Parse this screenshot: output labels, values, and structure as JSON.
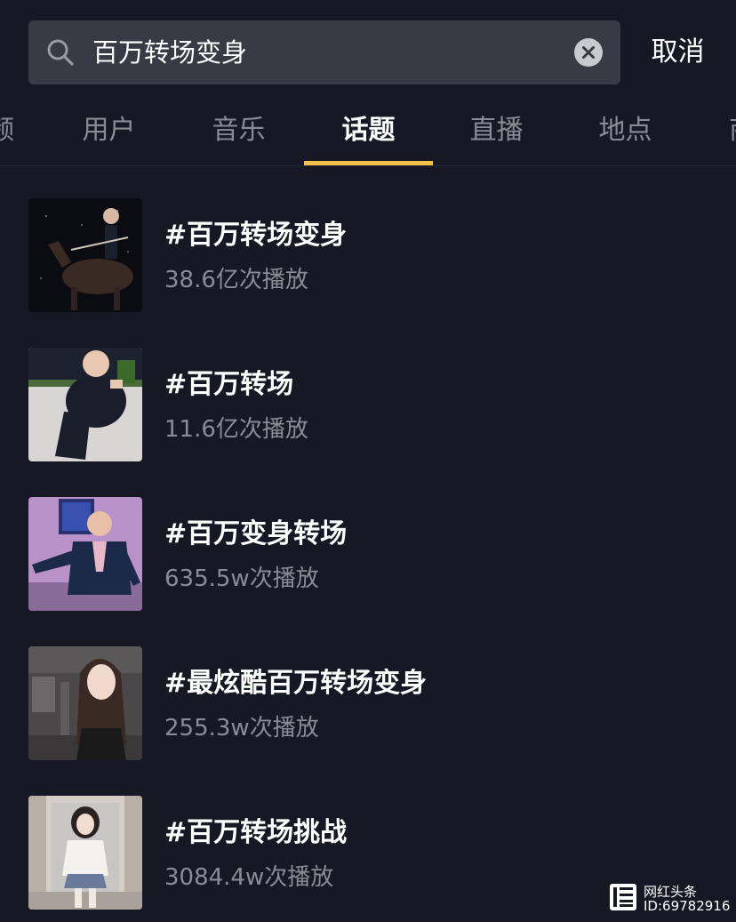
{
  "search": {
    "query": "百万转场变身",
    "cancel_label": "取消"
  },
  "tabs": [
    {
      "label": "频"
    },
    {
      "label": "用户"
    },
    {
      "label": "音乐"
    },
    {
      "label": "话题",
      "active": true
    },
    {
      "label": "直播"
    },
    {
      "label": "地点"
    },
    {
      "label": "商"
    }
  ],
  "topics": [
    {
      "title": "#百万转场变身",
      "views": "38.6亿次播放"
    },
    {
      "title": "#百万转场",
      "views": "11.6亿次播放"
    },
    {
      "title": "#百万变身转场",
      "views": "635.5w次播放"
    },
    {
      "title": "#最炫酷百万转场变身",
      "views": "255.3w次播放"
    },
    {
      "title": "#百万转场挑战",
      "views": "3084.4w次播放"
    }
  ],
  "watermark": {
    "line1": "网红头条",
    "line2": "ID:69782916"
  },
  "colors": {
    "background": "#161823",
    "search_bg": "#393b44",
    "tab_active_underline": "#f6c24a",
    "secondary_text": "#8b8c93"
  }
}
